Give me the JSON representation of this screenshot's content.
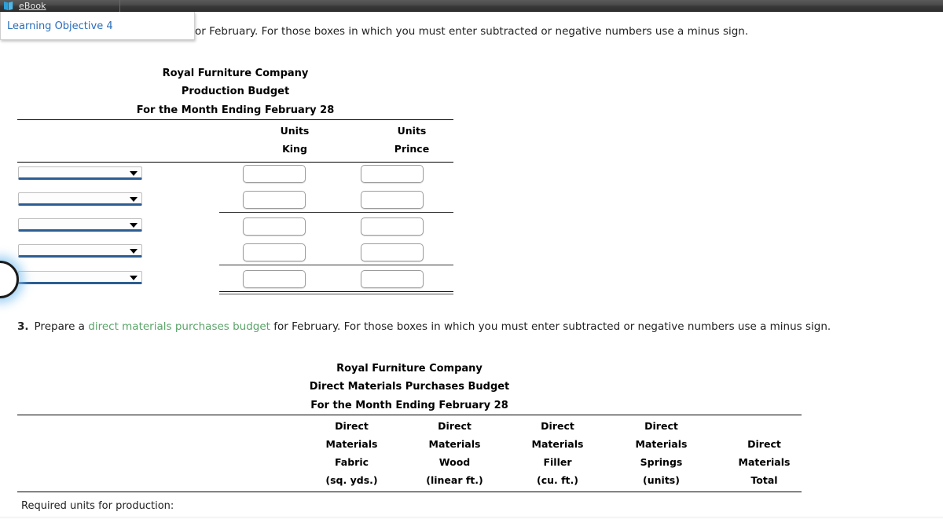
{
  "topbar": {
    "ebook_label": "eBook",
    "ebook_icon": "book-icon"
  },
  "popup": {
    "learning_objective_link": "Learning Objective 4"
  },
  "prompts": {
    "q2_visible_tail": "or February. For those boxes in which you must enter subtracted or negative numbers use a minus sign.",
    "q3_number": "3.",
    "q3_before_link": "Prepare a",
    "q3_link": "direct materials purchases budget",
    "q3_after_link": "for February. For those boxes in which you must enter subtracted or negative numbers use a minus sign."
  },
  "production_budget": {
    "title_line1": "Royal Furniture Company",
    "title_line2": "Production Budget",
    "title_line3": "For the Month Ending February 28",
    "columns": [
      {
        "line1": "Units",
        "line2": "King"
      },
      {
        "line1": "Units",
        "line2": "Prince"
      }
    ],
    "row_count": 5,
    "select_value": "",
    "input_value": ""
  },
  "direct_materials_budget": {
    "title_line1": "Royal Furniture Company",
    "title_line2": "Direct Materials Purchases Budget",
    "title_line3": "For the Month Ending February 28",
    "columns": [
      {
        "line1": "Direct",
        "line2": "Materials",
        "line3": "Fabric",
        "line4": "(sq. yds.)"
      },
      {
        "line1": "Direct",
        "line2": "Materials",
        "line3": "Wood",
        "line4": "(linear ft.)"
      },
      {
        "line1": "Direct",
        "line2": "Materials",
        "line3": "Filler",
        "line4": "(cu. ft.)"
      },
      {
        "line1": "Direct",
        "line2": "Materials",
        "line3": "Springs",
        "line4": "(units)"
      },
      {
        "line1": "",
        "line2": "Direct",
        "line3": "Materials",
        "line4": "Total"
      }
    ],
    "first_row_label": "Required units for production:"
  },
  "colors": {
    "link_blue": "#2a6ebb",
    "glossary_green": "#5aa469",
    "select_underline": "#2c5d92",
    "toolbar_dark": "#3a3a3a"
  }
}
